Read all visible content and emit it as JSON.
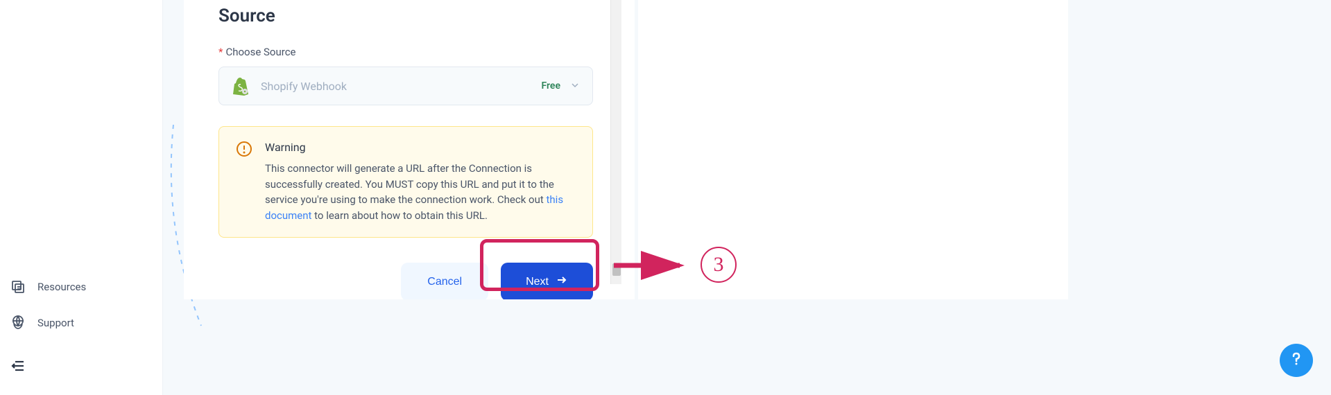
{
  "sidebar": {
    "resources_label": "Resources",
    "support_label": "Support"
  },
  "section": {
    "title": "Source",
    "field_label": "Choose Source"
  },
  "dropdown": {
    "value": "Shopify Webhook",
    "badge": "Free"
  },
  "warning": {
    "title": "Warning",
    "text_1": "This connector will generate a URL after the Connection is successfully created. You MUST copy this URL and put it to the service you're using to make the connection work. Check out ",
    "link_text": "this document",
    "text_2": " to learn about how to obtain this URL."
  },
  "buttons": {
    "cancel": "Cancel",
    "next": "Next"
  },
  "annotation": {
    "step_number": "3"
  }
}
